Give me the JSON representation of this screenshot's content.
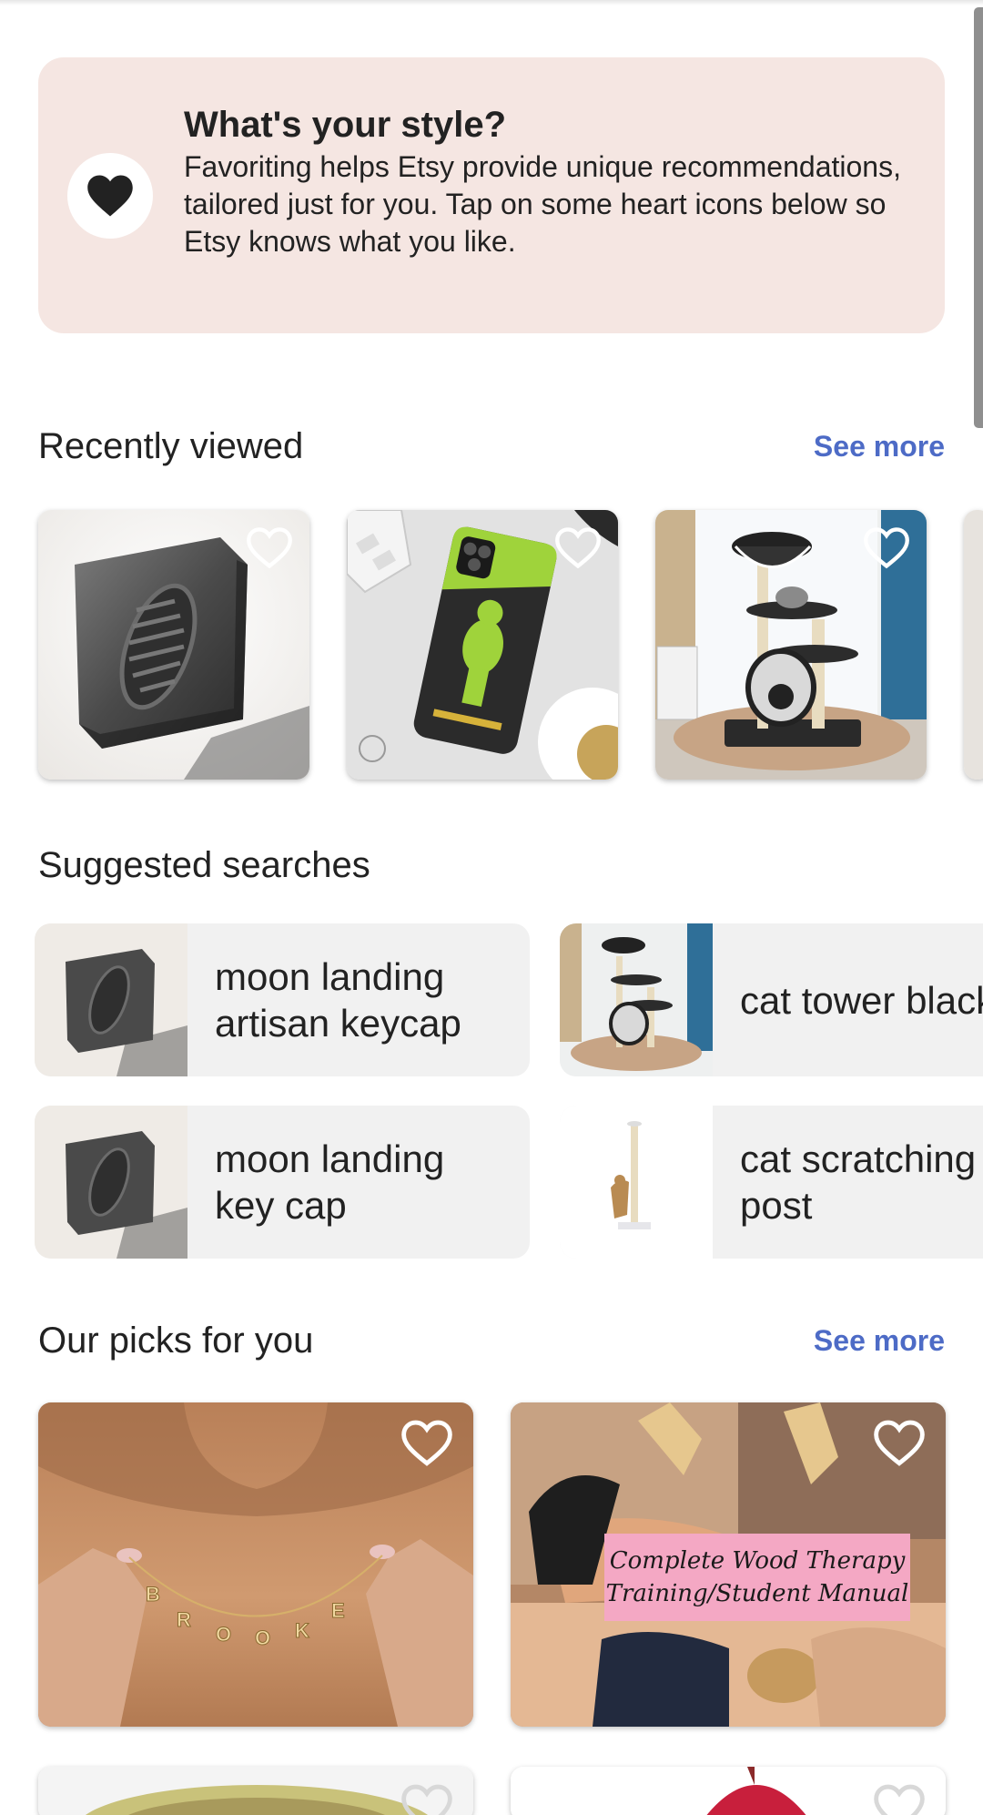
{
  "style_banner": {
    "title": "What's your style?",
    "body": "Favoriting helps Etsy provide unique recommendations, tailored just for you. Tap on some heart icons below so Etsy knows what you like.",
    "icon": "heart-icon",
    "background": "#f5e6e2"
  },
  "recently_viewed": {
    "title": "Recently viewed",
    "see_more": "See more",
    "items": [
      {
        "name": "moon landing keycap",
        "icon": "heart-outline-icon"
      },
      {
        "name": "phone case",
        "icon": "heart-outline-icon"
      },
      {
        "name": "cat tower",
        "icon": "heart-outline-icon"
      }
    ]
  },
  "suggested_searches": {
    "title": "Suggested searches",
    "items": [
      {
        "label": "moon landing artisan keycap"
      },
      {
        "label": "cat tower black"
      },
      {
        "label": "moon landing key cap"
      },
      {
        "label": "cat scratching post"
      }
    ]
  },
  "our_picks": {
    "title": "Our picks for you",
    "see_more": "See more",
    "items": [
      {
        "name": "name necklace",
        "image_text": "BROOKE"
      },
      {
        "name": "wood therapy manual",
        "image_text": "Complete Wood Therapy Training/Student Manual"
      }
    ]
  },
  "colors": {
    "accent_link": "#4d6bc6",
    "text": "#222222",
    "chip_bg": "#f1f1f1"
  }
}
